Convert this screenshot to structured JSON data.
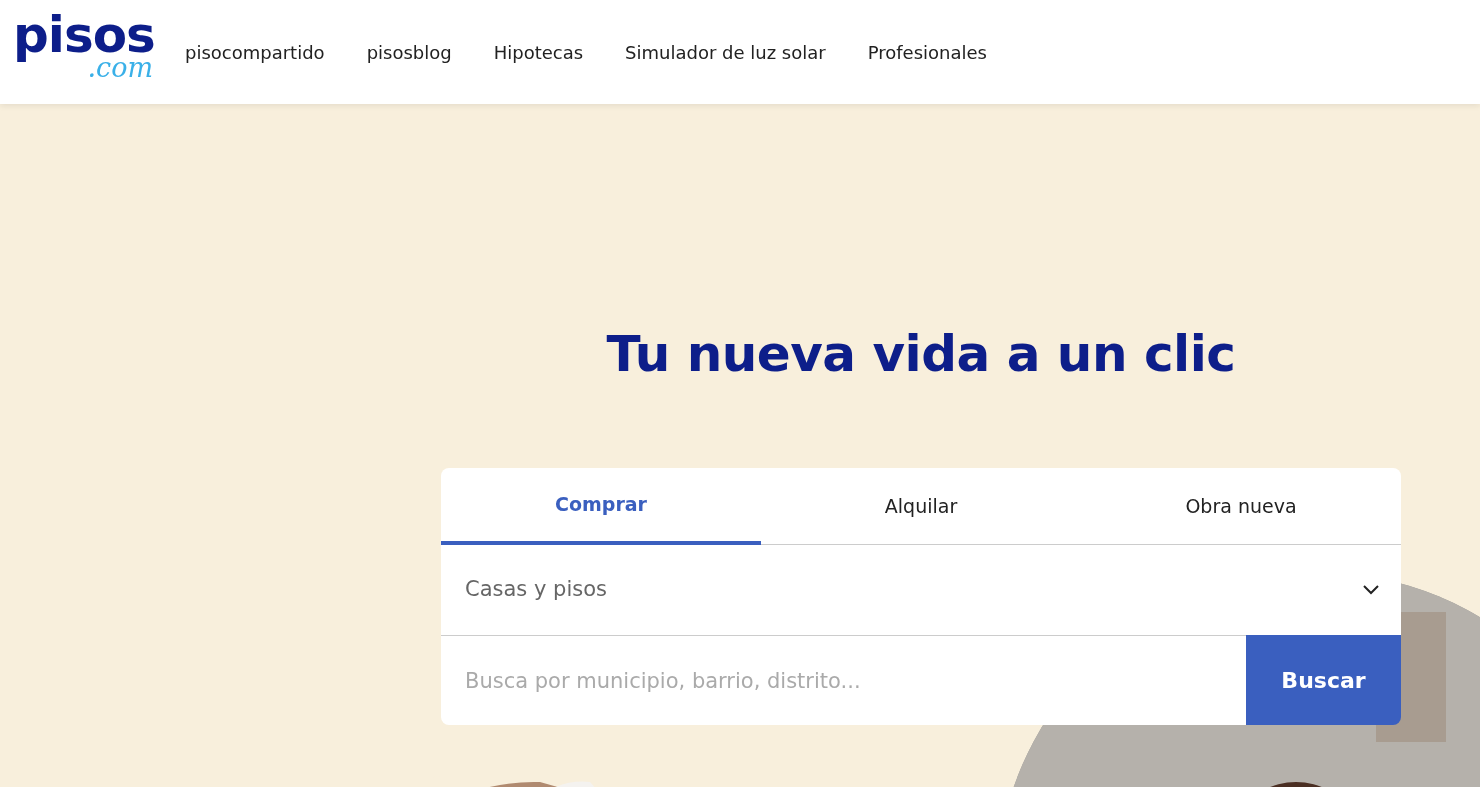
{
  "logo": {
    "name": "pisos",
    "suffix": ".com"
  },
  "nav": [
    "pisocompartido",
    "pisosblog",
    "Hipotecas",
    "Simulador de luz solar",
    "Profesionales"
  ],
  "hero": {
    "title": "Tu nueva vida a un clic"
  },
  "search": {
    "tabs": [
      {
        "label": "Comprar",
        "selected": true
      },
      {
        "label": "Alquilar",
        "selected": false
      },
      {
        "label": "Obra nueva",
        "selected": false
      }
    ],
    "property_type": "Casas y pisos",
    "placeholder": "Busca por municipio, barrio, distrito...",
    "button": "Buscar"
  }
}
